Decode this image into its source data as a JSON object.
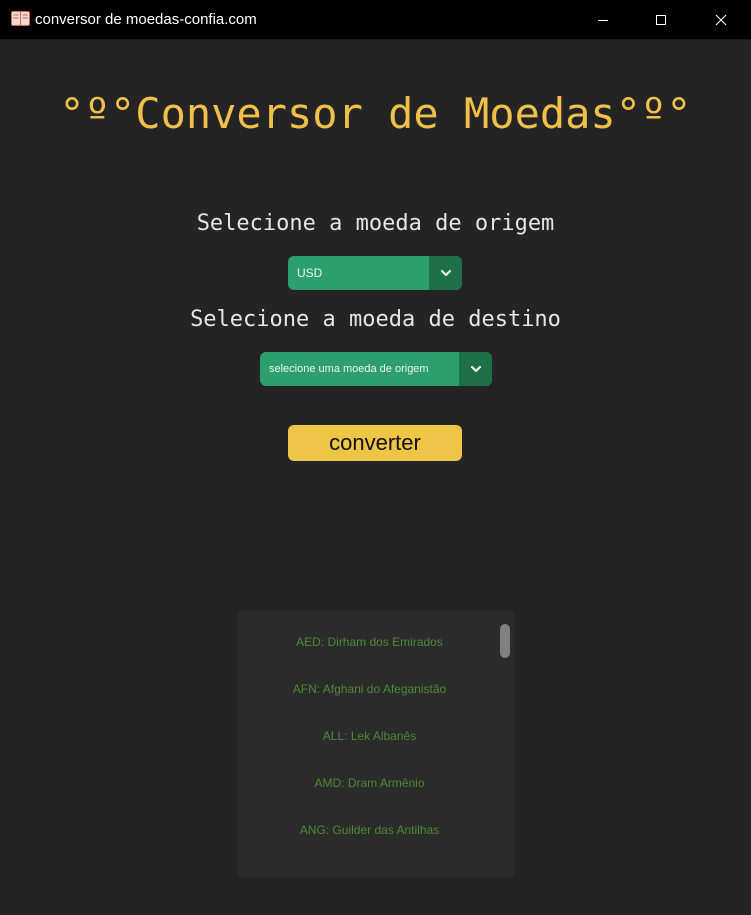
{
  "window": {
    "title": "conversor de moedas-confia.com",
    "app_icon": "book-icon",
    "controls": [
      "minimize-icon",
      "maximize-icon",
      "close-icon"
    ]
  },
  "main": {
    "heading": "°º°Conversor de Moedas°º°",
    "origin_label": "Selecione a moeda de origem",
    "origin_select": {
      "value": "USD",
      "icon": "chevron-down-icon"
    },
    "dest_label": "Selecione a moeda de destino",
    "dest_select": {
      "value": "selecione uma moeda de origem",
      "icon": "chevron-down-icon"
    },
    "convert_button": "converter"
  },
  "currency_list": {
    "items": [
      "AED: Dirham dos Emirados",
      "AFN: Afghani do Afeganistão",
      "ALL: Lek Albanês",
      "AMD: Dram Armênio",
      "ANG: Guilder das Antilhas"
    ]
  },
  "colors": {
    "background": "#242424",
    "titlebar": "#000000",
    "accent_yellow": "#f0c04a",
    "select_green": "#2c9f6e",
    "select_arrow_green": "#1d7048",
    "list_text_green": "#4d8a36"
  }
}
